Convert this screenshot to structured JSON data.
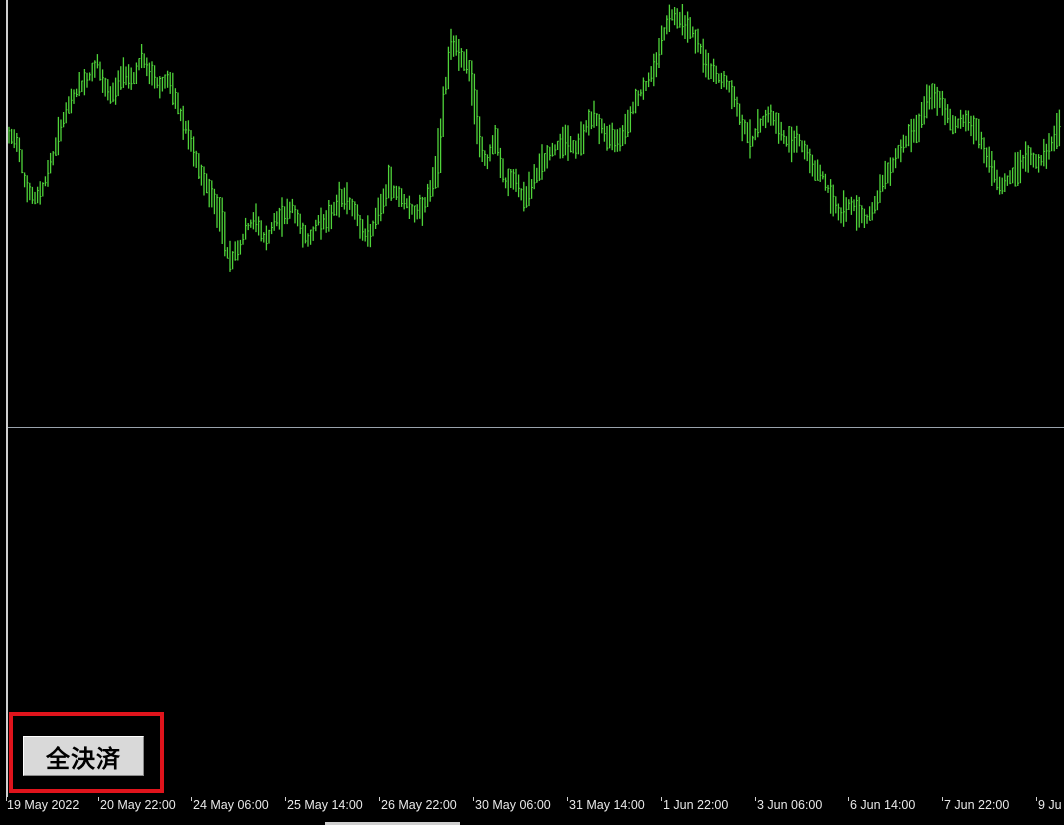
{
  "chart": {
    "background_color": "#000000",
    "bar_color": "#4fd43a",
    "separator_color": "#9aa3ad",
    "price_series_description": "OHLC bars, period roughly 2h, 19 May 2022 to 9 Jun",
    "price_path": [
      [
        0,
        62
      ],
      [
        1,
        60
      ],
      [
        2,
        34
      ],
      [
        3,
        30
      ],
      [
        4,
        38
      ],
      [
        5,
        52
      ],
      [
        6,
        70
      ],
      [
        7,
        80
      ],
      [
        8,
        88
      ],
      [
        9,
        92
      ],
      [
        10,
        100
      ],
      [
        11,
        82
      ],
      [
        12,
        86
      ],
      [
        13,
        96
      ],
      [
        14,
        92
      ],
      [
        15,
        102
      ],
      [
        16,
        94
      ],
      [
        17,
        88
      ],
      [
        18,
        92
      ],
      [
        19,
        78
      ],
      [
        20,
        66
      ],
      [
        21,
        52
      ],
      [
        22,
        38
      ],
      [
        23,
        30
      ],
      [
        24,
        12
      ],
      [
        25,
        0
      ],
      [
        26,
        6
      ],
      [
        27,
        16
      ],
      [
        28,
        20
      ],
      [
        29,
        8
      ],
      [
        30,
        18
      ],
      [
        31,
        22
      ],
      [
        32,
        26
      ],
      [
        33,
        14
      ],
      [
        34,
        8
      ],
      [
        35,
        20
      ],
      [
        36,
        18
      ],
      [
        37,
        28
      ],
      [
        38,
        32
      ],
      [
        39,
        24
      ],
      [
        40,
        10
      ],
      [
        41,
        14
      ],
      [
        42,
        26
      ],
      [
        43,
        38
      ],
      [
        44,
        32
      ],
      [
        45,
        28
      ],
      [
        46,
        22
      ],
      [
        47,
        28
      ],
      [
        48,
        40
      ],
      [
        49,
        78
      ],
      [
        50,
        112
      ],
      [
        51,
        104
      ],
      [
        52,
        96
      ],
      [
        53,
        58
      ],
      [
        54,
        48
      ],
      [
        55,
        62
      ],
      [
        56,
        38
      ],
      [
        57,
        40
      ],
      [
        58,
        32
      ],
      [
        59,
        36
      ],
      [
        60,
        48
      ],
      [
        61,
        52
      ],
      [
        62,
        58
      ],
      [
        63,
        62
      ],
      [
        64,
        54
      ],
      [
        65,
        66
      ],
      [
        66,
        72
      ],
      [
        67,
        66
      ],
      [
        68,
        60
      ],
      [
        69,
        62
      ],
      [
        70,
        72
      ],
      [
        71,
        82
      ],
      [
        72,
        88
      ],
      [
        73,
        98
      ],
      [
        74,
        116
      ],
      [
        75,
        126
      ],
      [
        76,
        122
      ],
      [
        77,
        118
      ],
      [
        78,
        108
      ],
      [
        79,
        98
      ],
      [
        80,
        92
      ],
      [
        81,
        90
      ],
      [
        82,
        80
      ],
      [
        83,
        66
      ],
      [
        84,
        60
      ],
      [
        85,
        70
      ],
      [
        86,
        74
      ],
      [
        87,
        66
      ],
      [
        88,
        58
      ],
      [
        89,
        62
      ],
      [
        90,
        54
      ],
      [
        91,
        46
      ],
      [
        92,
        42
      ],
      [
        93,
        30
      ],
      [
        94,
        22
      ],
      [
        95,
        28
      ],
      [
        96,
        24
      ],
      [
        97,
        20
      ],
      [
        98,
        30
      ],
      [
        99,
        42
      ],
      [
        100,
        50
      ],
      [
        101,
        58
      ],
      [
        102,
        64
      ],
      [
        103,
        72
      ],
      [
        104,
        82
      ],
      [
        105,
        80
      ],
      [
        106,
        74
      ],
      [
        107,
        68
      ],
      [
        108,
        72
      ],
      [
        109,
        66
      ],
      [
        110,
        58
      ],
      [
        111,
        46
      ],
      [
        112,
        36
      ],
      [
        113,
        40
      ],
      [
        114,
        48
      ],
      [
        115,
        52
      ],
      [
        116,
        48
      ],
      [
        117,
        52
      ],
      [
        118,
        60
      ],
      [
        119,
        70
      ]
    ]
  },
  "time_axis": {
    "labels": [
      "19 May 2022",
      "20 May 22:00",
      "24 May 06:00",
      "25 May 14:00",
      "26 May 22:00",
      "30 May 06:00",
      "31 May 14:00",
      "1 Jun 22:00",
      "3 Jun 06:00",
      "6 Jun 14:00",
      "7 Jun 22:00",
      "9 Ju"
    ]
  },
  "button": {
    "close_all_label": "全決済",
    "highlight_color": "#e0141c"
  }
}
